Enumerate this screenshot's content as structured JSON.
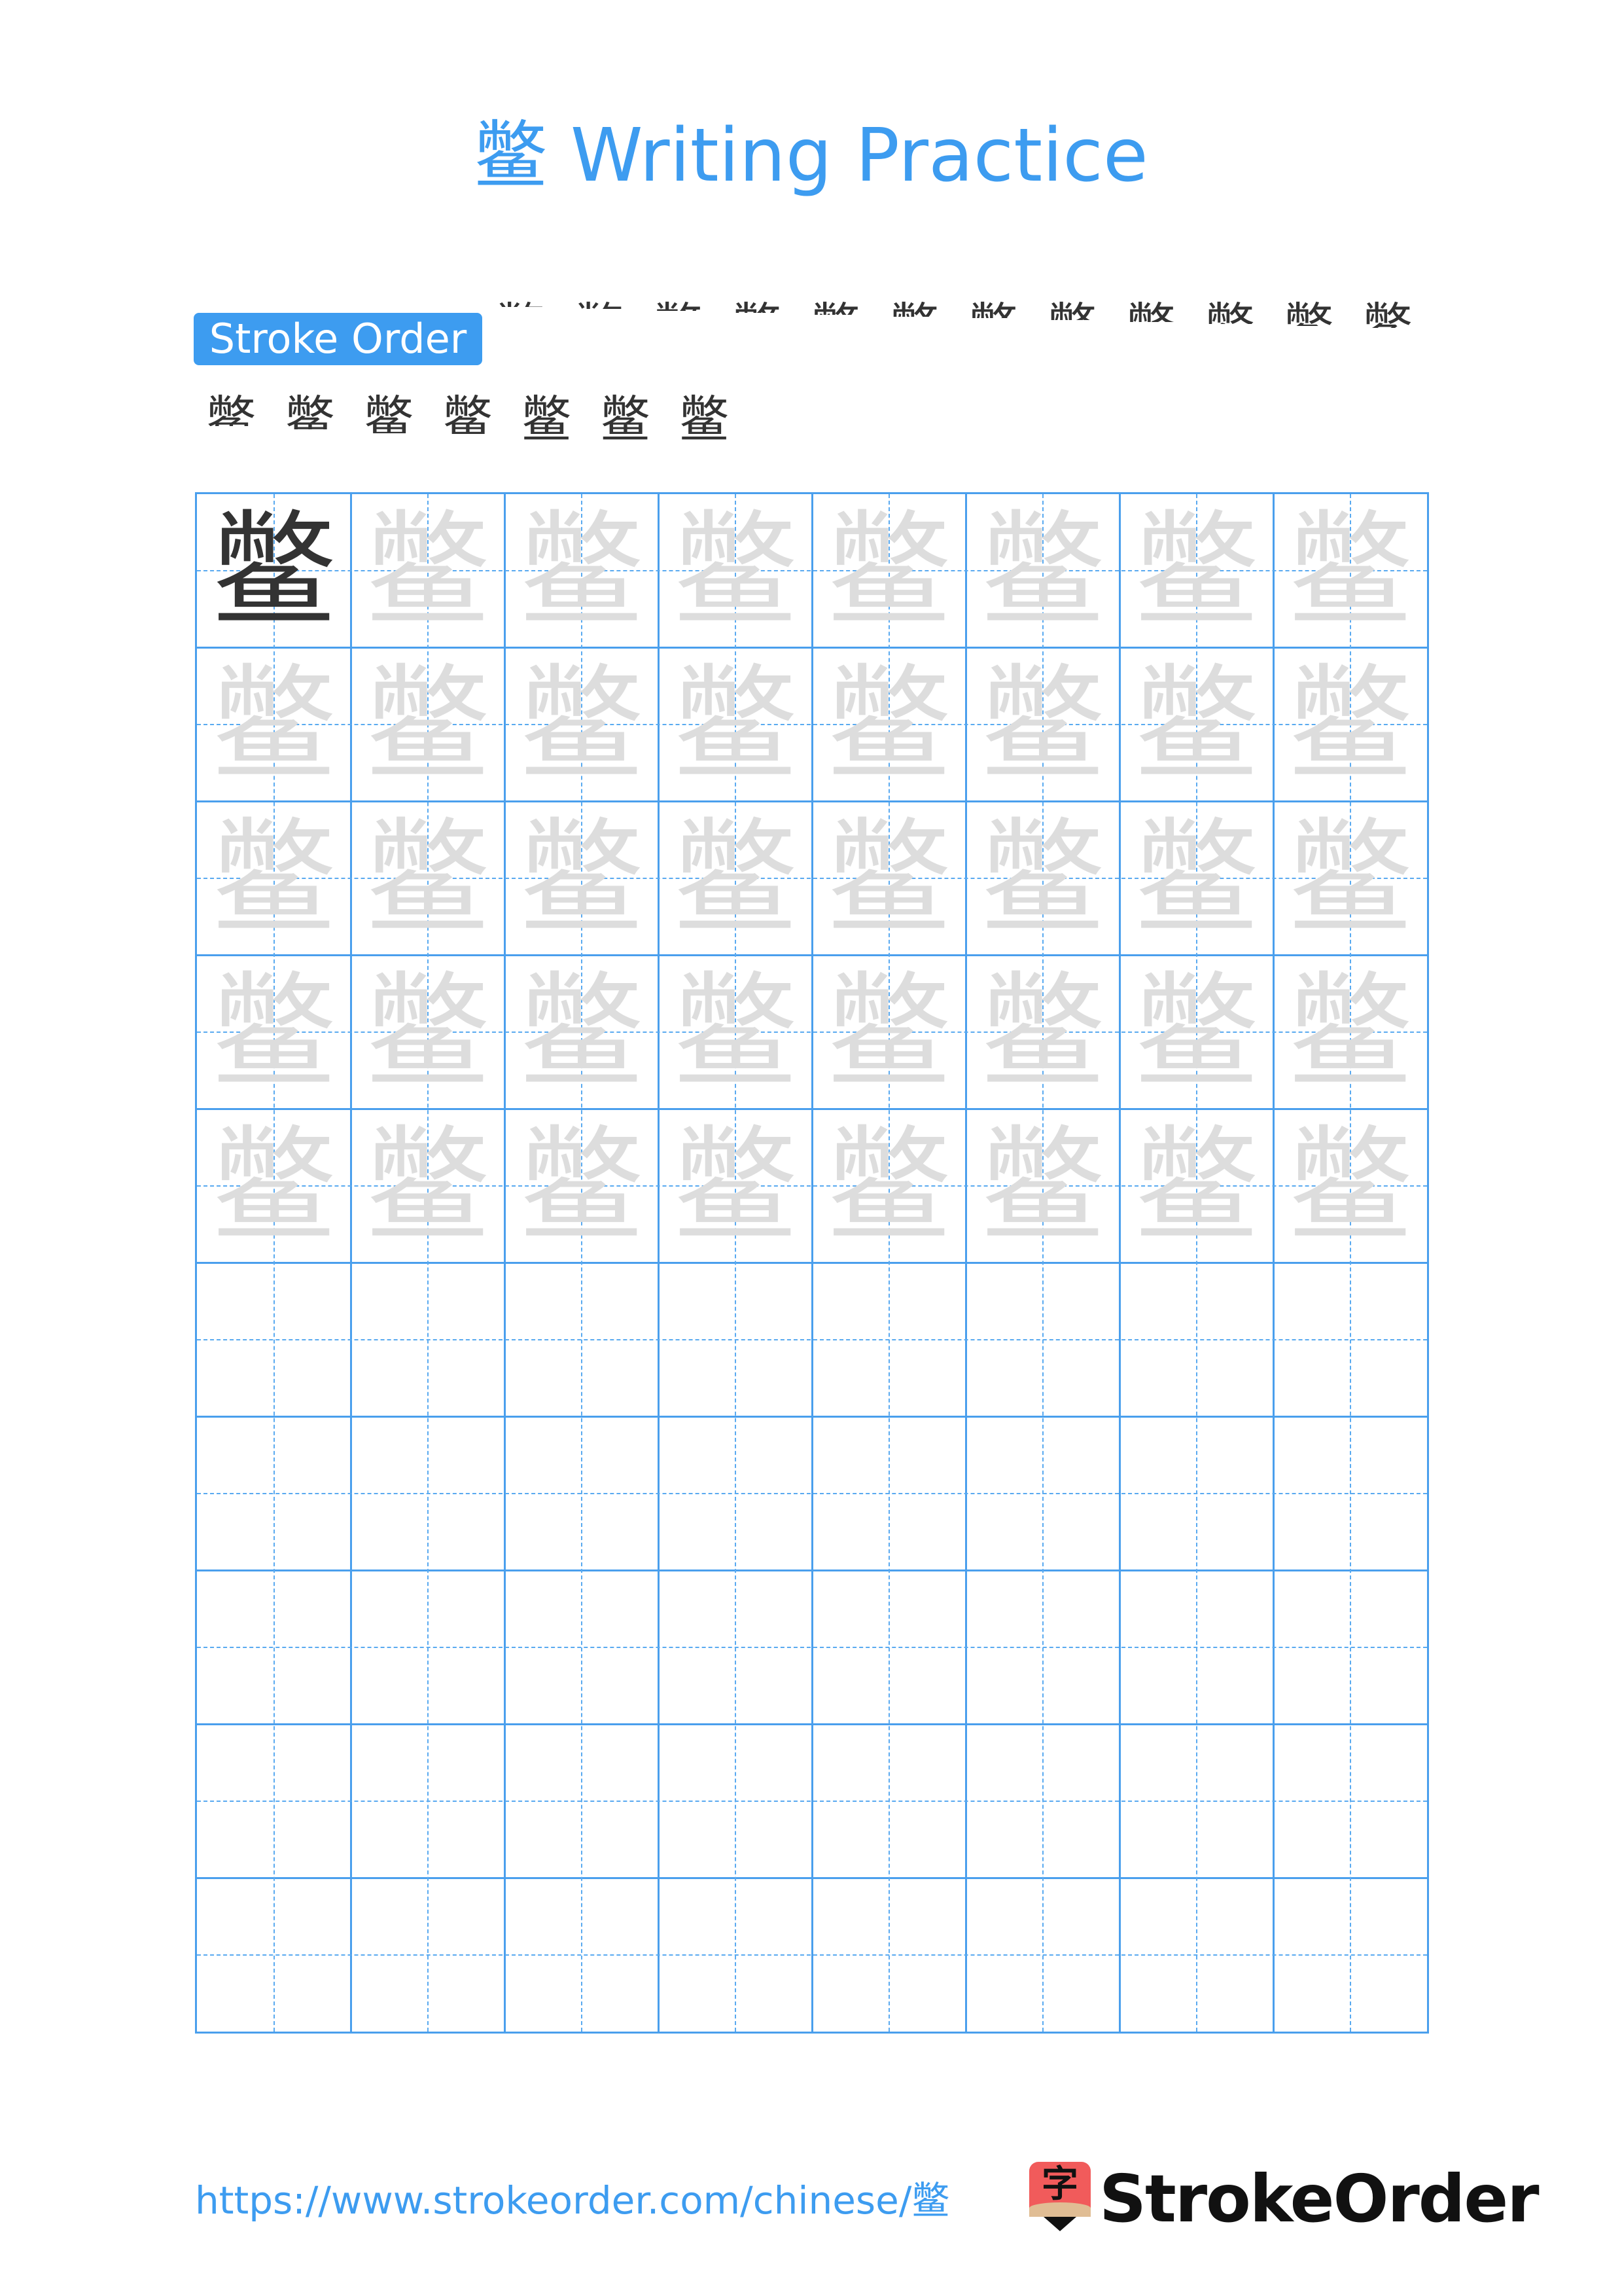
{
  "page": {
    "title": "鳖 Writing Practice",
    "character": "鳖"
  },
  "stroke_order": {
    "label": "Stroke Order",
    "total_strokes": 19,
    "steps": [
      1,
      2,
      3,
      4,
      5,
      6,
      7,
      8,
      9,
      10,
      11,
      12,
      13,
      14,
      15,
      16,
      16,
      18,
      19
    ]
  },
  "grid": {
    "columns": 8,
    "rows": 10,
    "model_cells": 1,
    "trace_rows": 5,
    "empty_rows": 5,
    "line_color": "#4a9fed",
    "trace_color": "#dddddd",
    "model_color": "#333333"
  },
  "footer": {
    "url": "https://www.strokeorder.com/chinese/鳖",
    "logo_glyph": "字",
    "brand": "StrokeOrder"
  },
  "colors": {
    "accent": "#3d9cf0",
    "stroke_highlight": "#ff0000",
    "logo_red": "#f15b5b"
  }
}
